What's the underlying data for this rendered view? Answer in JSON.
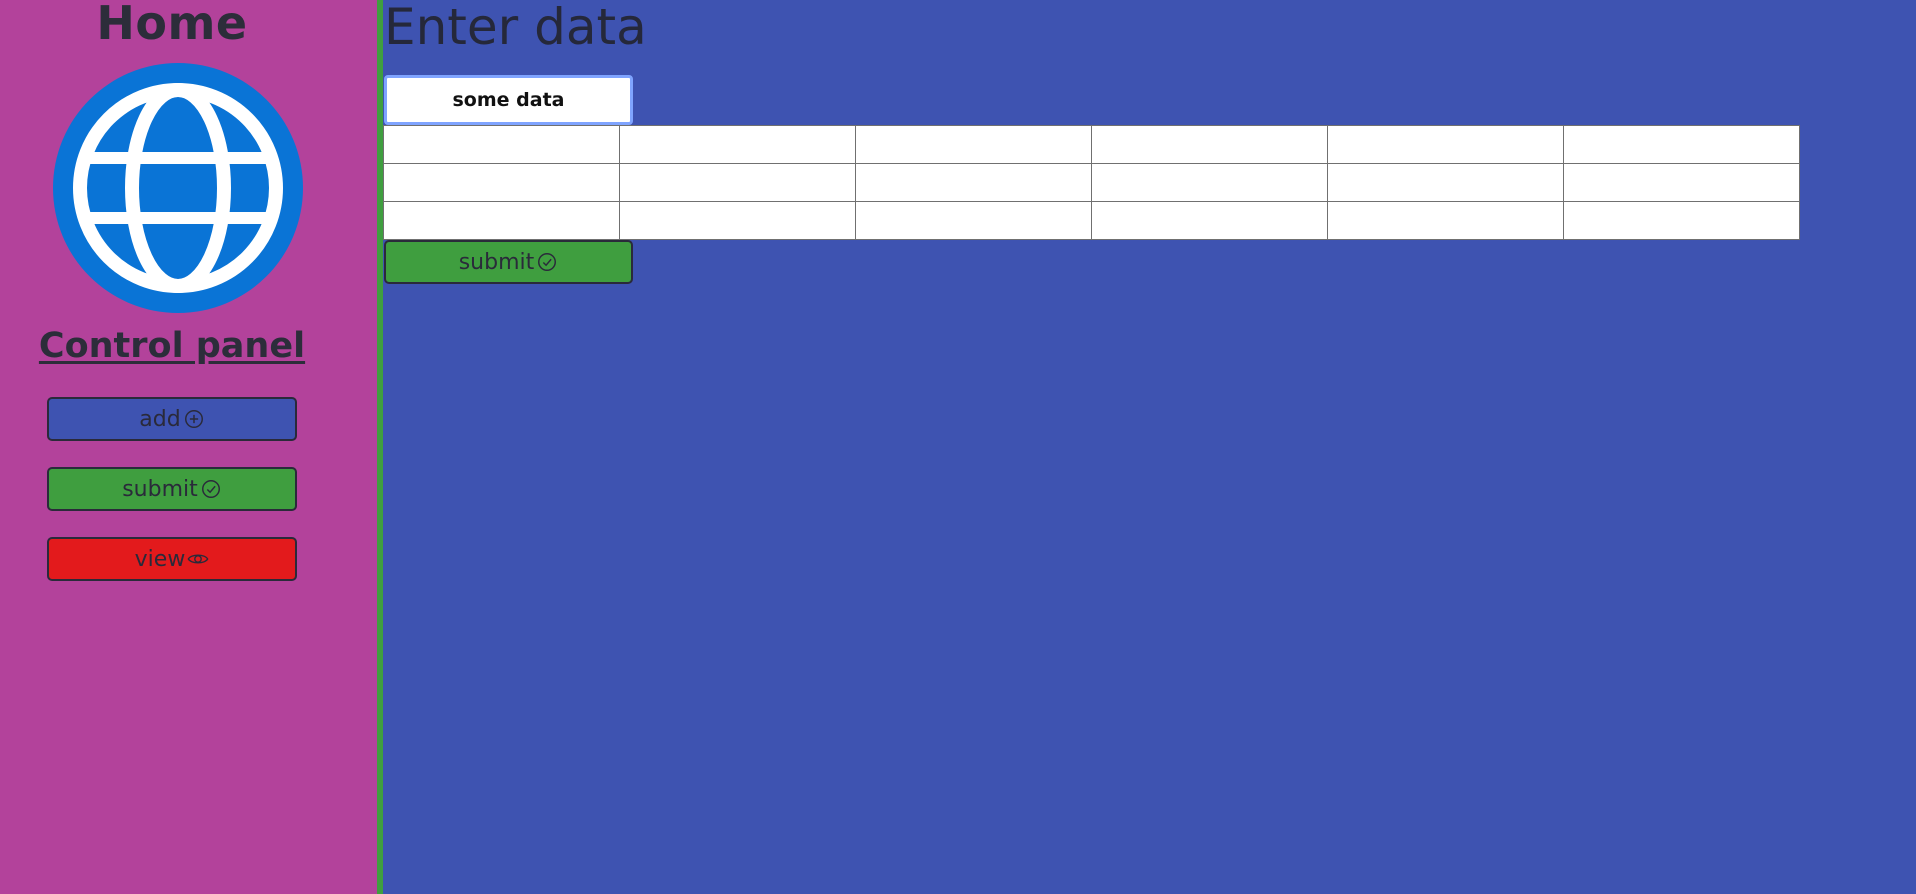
{
  "sidebar": {
    "title": "Home",
    "logo_icon": "globe-icon",
    "panel_title": "Control panel",
    "buttons": [
      {
        "label": "add",
        "icon": "plus-circle-icon",
        "color": "#3e53b1"
      },
      {
        "label": "submit",
        "icon": "check-circle-icon",
        "color": "#3f9e3f"
      },
      {
        "label": "view",
        "icon": "eye-icon",
        "color": "#e31a1c"
      }
    ]
  },
  "main": {
    "title": "Enter data",
    "input": {
      "value": "some data",
      "placeholder": ""
    },
    "table": {
      "rows": [
        [
          "",
          "",
          "",
          "",
          "",
          ""
        ],
        [
          "",
          "",
          "",
          "",
          "",
          ""
        ],
        [
          "",
          "",
          "",
          "",
          "",
          ""
        ]
      ]
    },
    "submit": {
      "label": "submit",
      "icon": "check-circle-icon"
    }
  },
  "colors": {
    "sidebar_bg": "#b3429b",
    "main_bg": "#3e53b1",
    "divider": "#3f9e3f",
    "globe_blue": "#0a74d6"
  }
}
